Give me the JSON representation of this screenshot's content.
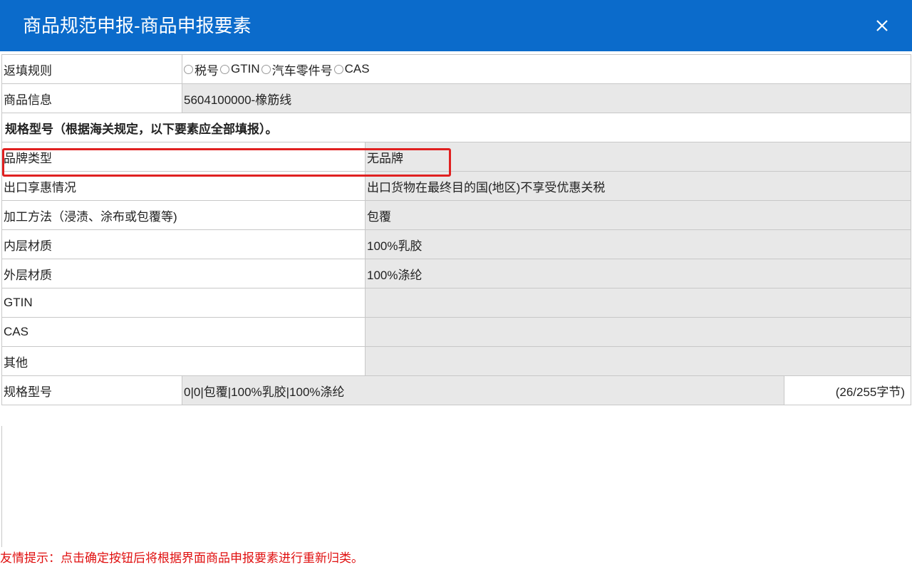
{
  "dialog": {
    "title": "商品规范申报-商品申报要素",
    "close_icon": "close-icon"
  },
  "fill_rule": {
    "label": "返填规则",
    "options": [
      "税号",
      "GTIN",
      "汽车零件号",
      "CAS"
    ]
  },
  "product_info": {
    "label": "商品信息",
    "value": "5604100000-橡筋线"
  },
  "spec_header": "规格型号（根据海关规定，以下要素应全部填报）。",
  "elements": [
    {
      "label": "品牌类型",
      "value": "无品牌"
    },
    {
      "label": "出口享惠情况",
      "value": "出口货物在最终目的国(地区)不享受优惠关税"
    },
    {
      "label": "加工方法（浸渍、涂布或包覆等)",
      "value": "包覆"
    },
    {
      "label": "内层材质",
      "value": "100%乳胶"
    },
    {
      "label": "外层材质",
      "value": "100%涤纶"
    },
    {
      "label": "GTIN",
      "value": ""
    },
    {
      "label": "CAS",
      "value": ""
    },
    {
      "label": "其他",
      "value": ""
    }
  ],
  "spec_model": {
    "label": "规格型号",
    "value": "0|0|包覆|100%乳胶|100%涤纶",
    "counter": "(26/255字节)"
  },
  "notice": "友情提示：点击确定按钮后将根据界面商品申报要素进行重新归类。",
  "colors": {
    "titlebar": "#0b6bcb",
    "highlight": "#e02020",
    "notice": "#e01010",
    "readonly_bg": "#e8e8e8"
  }
}
